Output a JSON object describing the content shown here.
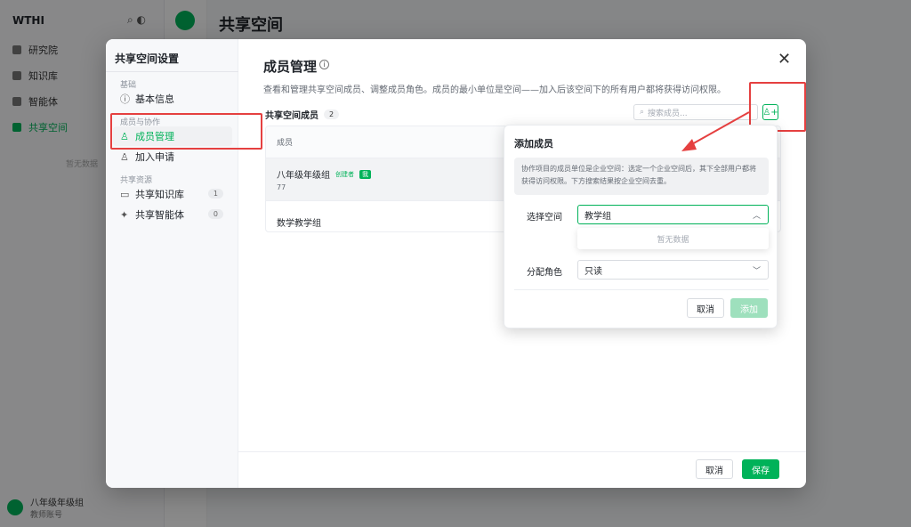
{
  "background": {
    "logo": "WTHI",
    "header_title": "共享空间",
    "nav": [
      "研究院",
      "知识库",
      "智能体",
      "共享空间"
    ],
    "muted_text": "暂无数据",
    "user_name": "八年级年级组",
    "user_sub": "教师账号"
  },
  "modal": {
    "sidebar_title": "共享空间设置",
    "groups": {
      "basic": "基础",
      "members": "成员与协作",
      "resources": "共享资源"
    },
    "items": {
      "basic_info": "基本信息",
      "member_manage": "成员管理",
      "join_requests": "加入申请",
      "shared_kb": "共享知识库",
      "shared_kb_count": "1",
      "shared_agent": "共享智能体",
      "shared_agent_count": "0"
    },
    "title": "成员管理",
    "desc": "查看和管理共享空间成员、调整成员角色。成员的最小单位是空间——加入后该空间下的所有用户都将获得访问权限。",
    "section_title": "共享空间成员",
    "member_count": "2",
    "search_placeholder": "搜索成员...",
    "table": {
      "col_member": "成员",
      "rows": [
        {
          "name": "八年级年级组",
          "creator_tag": "创建者",
          "tag": "我",
          "sub": "77"
        },
        {
          "name": "数学教学组"
        }
      ]
    },
    "cancel_label": "取消",
    "save_label": "保存"
  },
  "popover": {
    "title": "添加成员",
    "note": "协作项目的成员单位是企业空间：选定一个企业空间后，其下全部用户都将获得访问权限。下方搜索结果按企业空间去重。",
    "space_label": "选择空间",
    "space_value": "教学组",
    "empty_text": "暂无数据",
    "role_label": "分配角色",
    "role_value": "只读",
    "cancel_label": "取消",
    "add_label": "添加"
  },
  "colors": {
    "accent": "#00b259",
    "annotation": "#e54040"
  }
}
